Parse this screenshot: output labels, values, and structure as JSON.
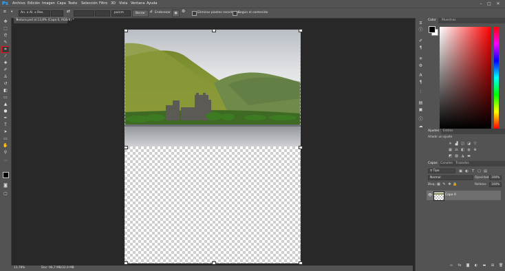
{
  "app": {
    "logo": "Ps"
  },
  "menu": [
    "Archivo",
    "Edición",
    "Imagen",
    "Capa",
    "Texto",
    "Selección",
    "Filtro",
    "3D",
    "Vista",
    "Ventana",
    "Ayuda"
  ],
  "window_controls": [
    "–",
    "□",
    "✕"
  ],
  "options_bar": {
    "ratio_value": "An. x Al. x Res.",
    "unit_value": "px/cm",
    "clear_label": "Borrar",
    "straighten_label": "Enderezar",
    "delete_cropped_label": "Eliminar píxeles recortados",
    "content_aware_label": "Según el contenido"
  },
  "document_tab": {
    "title": "Textura.psd al 13,8% (Capa 0, RGB/8) *",
    "close": "×"
  },
  "status": {
    "zoom": "13,78%",
    "doc": "Doc: 96,7 MB/32,9 MB"
  },
  "panels": {
    "color": {
      "tabs": [
        "Color",
        "Muestras"
      ],
      "fg": "#000000",
      "bg": "#ffffff"
    },
    "adjustments": {
      "tabs": [
        "Ajustes",
        "Estilos"
      ],
      "hint": "Añadir un ajuste"
    },
    "layers": {
      "tabs": [
        "Capas",
        "Canales",
        "Trazados"
      ],
      "filter_value": "Tipo",
      "blend_mode": "Normal",
      "opacity_label": "Opacidad:",
      "opacity_value": "100%",
      "lock_label": "Bloq.:",
      "fill_label": "Relleno:",
      "fill_value": "100%",
      "layer_name": "Capa 0"
    }
  },
  "colors": {
    "crop_highlight": "#e1151b",
    "ps_blue": "#31a8ff"
  }
}
